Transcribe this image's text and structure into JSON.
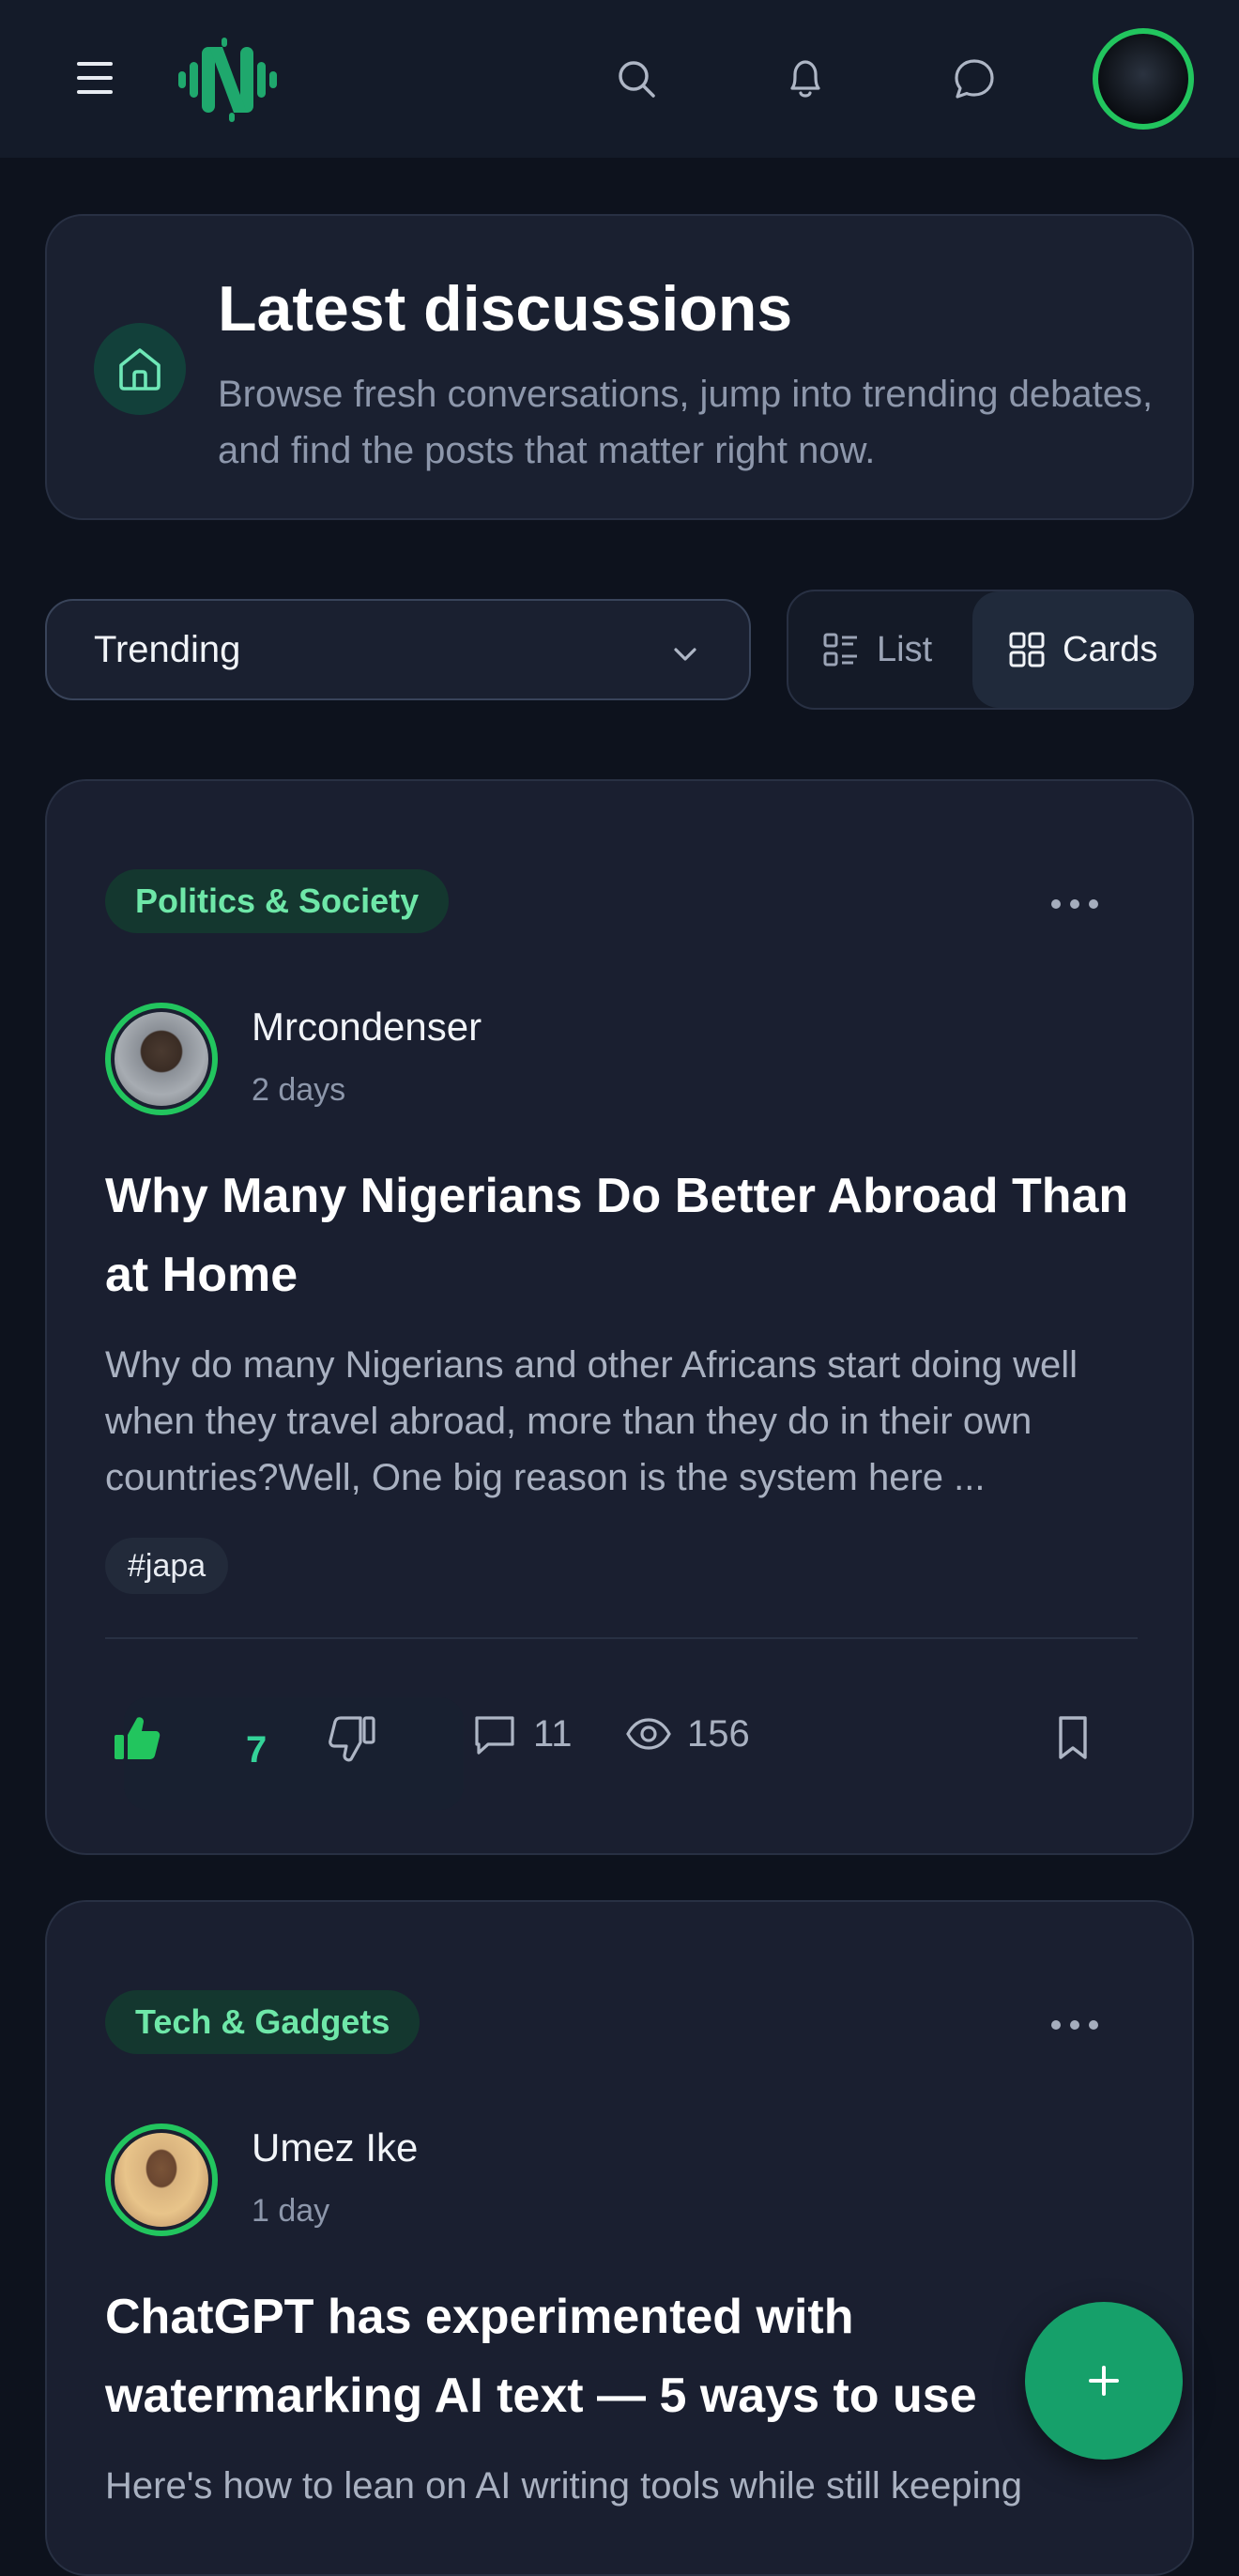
{
  "header": {
    "menu_icon": "hamburger-icon",
    "logo_icon": "brand-logo-icon",
    "search_icon": "search-icon",
    "notifications_icon": "bell-icon",
    "messages_icon": "chat-bubble-icon",
    "accent_color": "#22c55e"
  },
  "hero": {
    "icon": "home-icon",
    "title": "Latest discussions",
    "description": "Browse fresh conversations, jump into trending debates, and find the posts that matter right now."
  },
  "controls": {
    "sort_selected": "Trending",
    "view_list_label": "List",
    "view_cards_label": "Cards",
    "active_view": "Cards"
  },
  "posts": [
    {
      "category": "Politics & Society",
      "author": "Mrcondenser",
      "time": "2 days",
      "title": "Why Many Nigerians Do Better Abroad Than at Home",
      "excerpt": "Why do many Nigerians and other Africans start doing well when they travel abroad, more than they do in their own countries?Well, One big reason is the system here ...",
      "tag": "#japa",
      "upvotes": "7",
      "comments": "11",
      "views": "156",
      "liked": true
    },
    {
      "category": "Tech & Gadgets",
      "author": "Umez Ike",
      "time": "1 day",
      "title": "ChatGPT has experimented with watermarking AI text — 5 ways to use",
      "excerpt": "Here's how to lean on AI writing tools while still keeping"
    }
  ],
  "fab": {
    "icon": "plus-icon"
  }
}
